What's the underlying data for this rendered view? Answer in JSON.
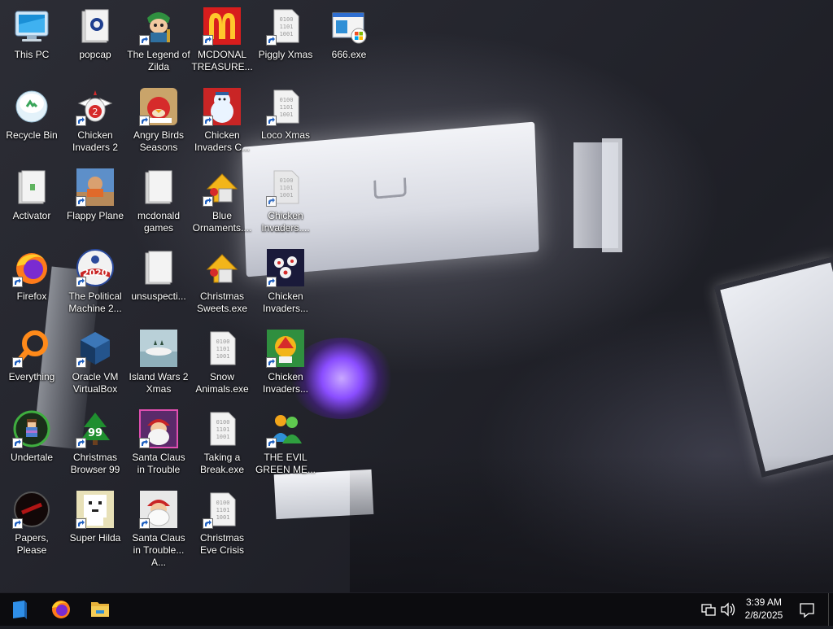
{
  "desktop": {
    "icons": [
      {
        "label": "This PC",
        "icon": "computer-icon"
      },
      {
        "label": "popcap",
        "icon": "folder-icon"
      },
      {
        "label": "The Legend of Zilda",
        "icon": "game-character-icon"
      },
      {
        "label": "MCDONAL TREASURE...",
        "icon": "mcdonalds-logo-icon"
      },
      {
        "label": "Piggly Xmas",
        "icon": "binary-file-icon"
      },
      {
        "label": "666.exe",
        "icon": "windows-installer-icon"
      },
      {
        "label": "Recycle Bin",
        "icon": "recycle-bin-icon"
      },
      {
        "label": "Chicken Invaders 2",
        "icon": "chicken-icon"
      },
      {
        "label": "Angry Birds Seasons",
        "icon": "angry-birds-icon"
      },
      {
        "label": "Chicken Invaders C...",
        "icon": "snowman-icon"
      },
      {
        "label": "Loco Xmas",
        "icon": "binary-file-icon"
      },
      {
        "label": "Activator",
        "icon": "folder-icon"
      },
      {
        "label": "Flappy Plane",
        "icon": "flappy-plane-icon"
      },
      {
        "label": "mcdonald games",
        "icon": "folder-icon"
      },
      {
        "label": "Blue Ornaments....",
        "icon": "ornament-installer-icon"
      },
      {
        "label": "Chicken Invaders....",
        "icon": "binary-file-icon"
      },
      {
        "label": "Firefox",
        "icon": "firefox-icon"
      },
      {
        "label": "The Political Machine 2...",
        "icon": "political-machine-icon"
      },
      {
        "label": "unsuspecti...",
        "icon": "folder-icon"
      },
      {
        "label": "Christmas Sweets.exe",
        "icon": "ornament-installer-icon"
      },
      {
        "label": "Chicken Invaders...",
        "icon": "chicken-invaders-icon"
      },
      {
        "label": "Everything",
        "icon": "search-magnifier-icon"
      },
      {
        "label": "Oracle VM VirtualBox",
        "icon": "virtualbox-icon"
      },
      {
        "label": "Island Wars 2 Xmas",
        "icon": "island-wars-icon"
      },
      {
        "label": "Snow Animals.exe",
        "icon": "binary-file-icon"
      },
      {
        "label": "Chicken Invaders...",
        "icon": "chicken-invaders-icon"
      },
      {
        "label": "Undertale",
        "icon": "undertale-icon"
      },
      {
        "label": "Christmas Browser 99",
        "icon": "christmas-tree-icon"
      },
      {
        "label": "Santa Claus in Trouble",
        "icon": "santa-icon"
      },
      {
        "label": "Taking a Break.exe",
        "icon": "binary-file-icon"
      },
      {
        "label": "THE EVIL GREEN ME...",
        "icon": "messenger-people-icon"
      },
      {
        "label": "Papers, Please",
        "icon": "papers-please-icon"
      },
      {
        "label": "Super Hilda",
        "icon": "pixel-character-icon"
      },
      {
        "label": "Santa Claus in Trouble... A...",
        "icon": "santa-icon"
      },
      {
        "label": "Christmas Eve Crisis",
        "icon": "binary-file-icon"
      }
    ]
  },
  "taskbar": {
    "start": {
      "icon": "start-icon"
    },
    "pinned": [
      {
        "name": "Firefox",
        "icon": "firefox-icon"
      },
      {
        "name": "File Explorer",
        "icon": "folder-icon"
      }
    ],
    "tray": {
      "network_icon": "network-icon",
      "volume_icon": "volume-icon",
      "time": "3:39 AM",
      "date": "2/8/2025",
      "notification_icon": "notification-icon"
    }
  }
}
